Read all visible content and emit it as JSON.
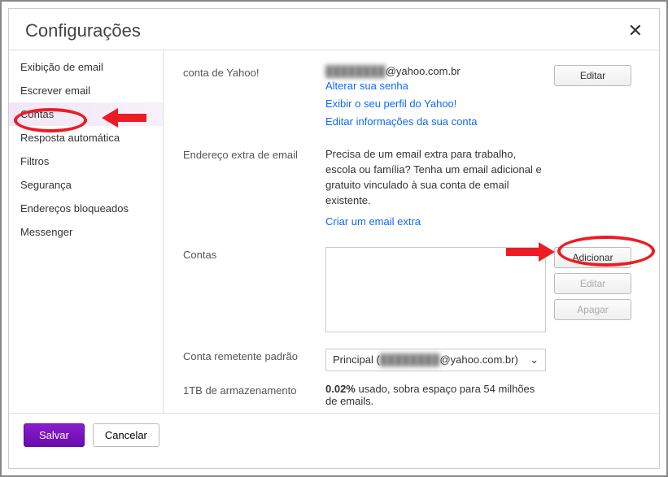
{
  "dialog": {
    "title": "Configurações",
    "close": "✕"
  },
  "sidebar": {
    "items": [
      {
        "label": "Exibição de email"
      },
      {
        "label": "Escrever email"
      },
      {
        "label": "Contas",
        "active": true
      },
      {
        "label": "Resposta automática"
      },
      {
        "label": "Filtros"
      },
      {
        "label": "Segurança"
      },
      {
        "label": "Endereços bloqueados"
      },
      {
        "label": "Messenger"
      }
    ]
  },
  "sections": {
    "yahoo_account": {
      "label": "conta de Yahoo!",
      "email_hidden_prefix": "████████",
      "email_suffix": "@yahoo.com.br",
      "edit": "Editar",
      "links": {
        "change_pw": "Alterar sua senha",
        "show_profile": "Exibir o seu perfil do Yahoo!",
        "edit_info": "Editar informações da sua conta"
      }
    },
    "extra_email": {
      "label": "Endereço extra de email",
      "desc": "Precisa de um email extra para trabalho, escola ou família? Tenha um email adicional e gratuito vinculado à sua conta de email existente.",
      "link": "Criar um email extra"
    },
    "accounts": {
      "label": "Contas",
      "add": "Adicionar",
      "edit": "Editar",
      "delete": "Apagar"
    },
    "default_sender": {
      "label": "Conta remetente padrão",
      "select_prefix": "Principal (",
      "select_hidden": "████████",
      "select_suffix": "@yahoo.com.br)",
      "chevron": "⌄"
    },
    "storage": {
      "label": "1TB de armazenamento",
      "usage_pct": "0.02%",
      "usage_rest": " usado, sobra espaço para 54 milhões de emails."
    }
  },
  "footer": {
    "save": "Salvar",
    "cancel": "Cancelar"
  }
}
